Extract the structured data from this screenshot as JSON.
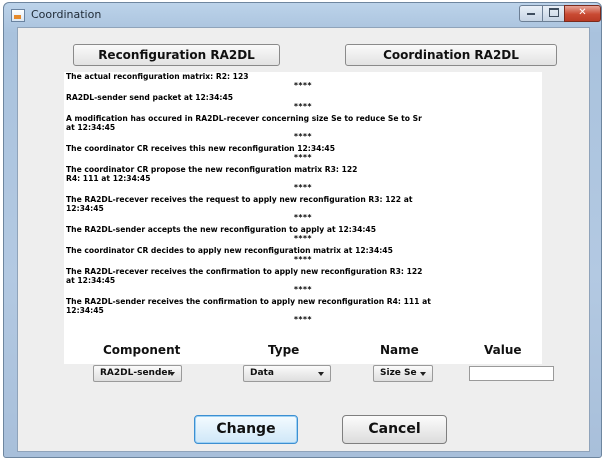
{
  "window": {
    "title": "Coordination",
    "controls": {
      "minimize": "–",
      "maximize": "□",
      "close": "✕"
    }
  },
  "toolbar": {
    "reconfiguration_label": "Reconfiguration RA2DL",
    "coordination_label": "Coordination  RA2DL"
  },
  "log": {
    "separator": "****",
    "entries": [
      "The actual reconfiguration matrix: R2: 123",
      "RA2DL-sender send packet  at 12:34:45",
      "A modification has occured in RA2DL-recever concerning size Se to reduce Se  to Sr\nat 12:34:45",
      "The coordinator CR receives this new reconfiguration 12:34:45",
      "The coordinator CR propose the new reconfiguration matrix R3: 122\nR4: 111 at 12:34:45",
      "The RA2DL-recever receives the request to apply new reconfiguration R3: 122 at\n12:34:45",
      "The RA2DL-sender accepts the new reconfiguration to apply at 12:34:45",
      "The coordinator CR decides to apply new reconfiguration matrix at 12:34:45",
      "The RA2DL-recever receives the confirmation to apply new reconfiguration R3: 122\nat 12:34:45",
      "The RA2DL-sender receives the confirmation to apply new reconfiguration R4: 111 at\n12:34:45"
    ]
  },
  "form": {
    "headers": {
      "component": "Component",
      "type": "Type",
      "name": "Name",
      "value": "Value"
    },
    "component_selected": "RA2DL-sender",
    "type_selected": "Data",
    "name_selected": "Size Se",
    "value_text": "",
    "value_placeholder": ""
  },
  "actions": {
    "change_label": "Change",
    "cancel_label": "Cancel"
  },
  "colors": {
    "window_frame": "#a9c2dd",
    "pane_background": "#eeeeee",
    "close_button": "#c94a33",
    "default_button_focus": "#3c8fd1"
  },
  "icons": [
    "app-icon",
    "chevron-down-icon"
  ]
}
